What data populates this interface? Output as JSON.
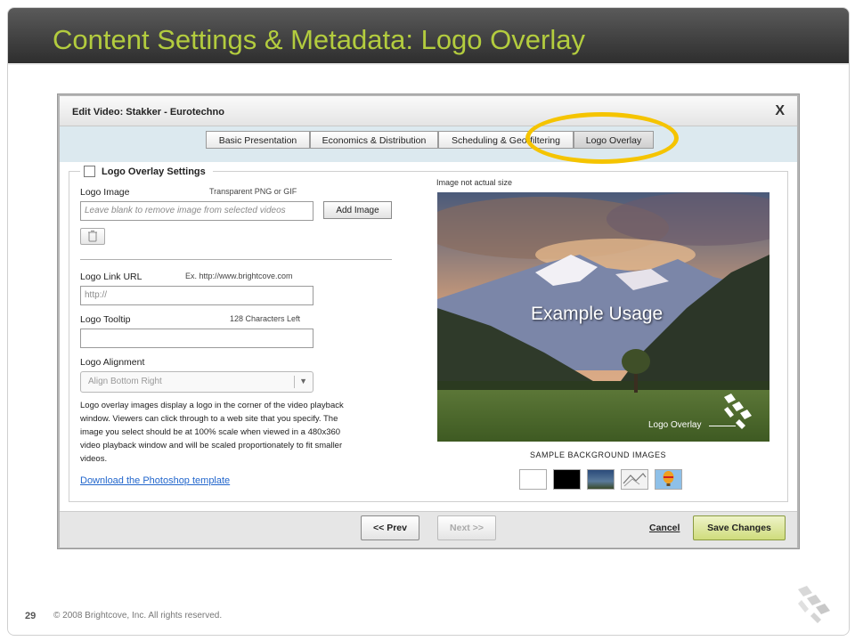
{
  "slide": {
    "title": "Content Settings & Metadata: Logo Overlay",
    "page_number": "29",
    "copyright": "© 2008 Brightcove, Inc. All rights reserved.",
    "title_color": "#b3cc3e",
    "highlight_color": "#f5c400"
  },
  "dialog": {
    "title": "Edit Video: Stakker - Eurotechno",
    "close_label": "X",
    "tabs": [
      {
        "label": "Basic Presentation"
      },
      {
        "label": "Economics & Distribution"
      },
      {
        "label": "Scheduling & Geo-filtering"
      },
      {
        "label": "Logo Overlay",
        "active": true
      }
    ],
    "settings": {
      "legend": "Logo Overlay Settings",
      "logo_image_label": "Logo Image",
      "logo_image_hint": "Transparent PNG or GIF",
      "logo_image_placeholder": "Leave blank to remove image from selected videos",
      "add_image_button": "Add Image",
      "link_url_label": "Logo Link URL",
      "link_url_hint": "Ex. http://www.brightcove.com",
      "link_url_value": "http://",
      "tooltip_label": "Logo Tooltip",
      "tooltip_hint": "128 Characters Left",
      "tooltip_value": "",
      "alignment_label": "Logo Alignment",
      "alignment_value": "Align Bottom Right",
      "description": "Logo overlay images display a logo in the corner of the video playback window. Viewers can click through to a web site that you specify. The image you select should be at 100% scale when viewed in a 480x360 video playback window and will be scaled proportionately to fit smaller videos.",
      "download_link": "Download the Photoshop template"
    },
    "preview": {
      "note": "Image not actual size",
      "example_text": "Example Usage",
      "overlay_label": "Logo Overlay",
      "samples_title": "SAMPLE BACKGROUND IMAGES",
      "samples": [
        "white",
        "black",
        "blue-landscape",
        "sketch",
        "balloon"
      ]
    },
    "footer": {
      "prev": "<< Prev",
      "next": "Next >>",
      "cancel": "Cancel",
      "save": "Save Changes",
      "accent_color": "#cfdc7c"
    }
  }
}
